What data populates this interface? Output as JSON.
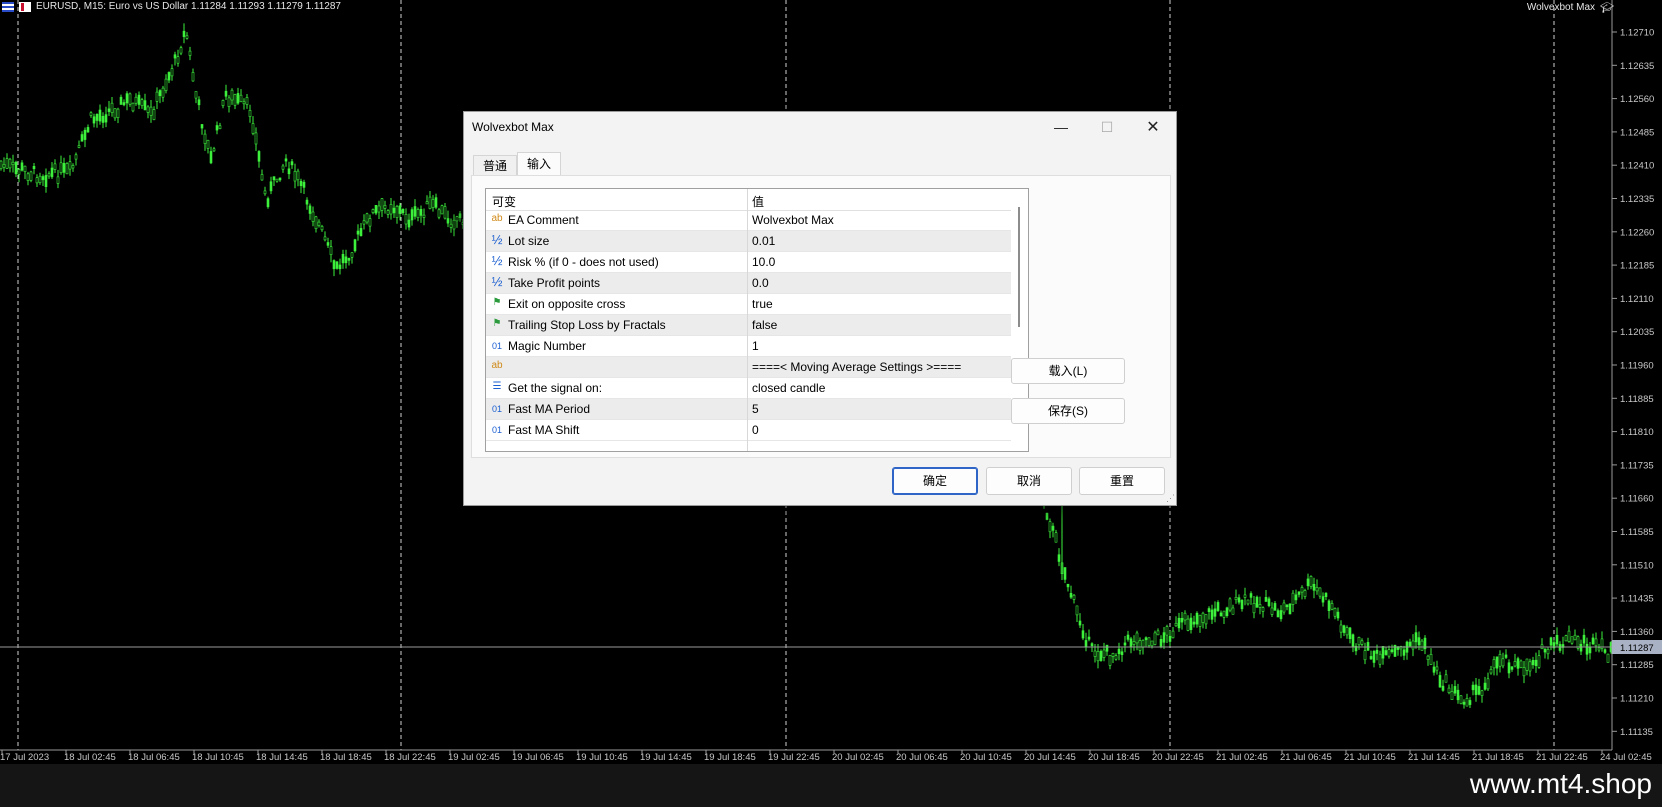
{
  "chart": {
    "header_text": "EURUSD, M15:  Euro vs US Dollar  1.11284 1.11293 1.11279 1.11287",
    "ea_name": "Wolvexbot Max",
    "current_price": "1.11287",
    "candle_color": "#3cf03c",
    "price_ticks": [
      "1.12710",
      "1.12635",
      "1.12560",
      "1.12485",
      "1.12410",
      "1.12335",
      "1.12260",
      "1.12185",
      "1.12110",
      "1.12035",
      "1.11960",
      "1.11885",
      "1.11810",
      "1.11735",
      "1.11660",
      "1.11585",
      "1.11510",
      "1.11435",
      "1.11360",
      "1.11285",
      "1.11210",
      "1.11135"
    ],
    "time_ticks": [
      "17 Jul 2023",
      "18 Jul 02:45",
      "18 Jul 06:45",
      "18 Jul 10:45",
      "18 Jul 14:45",
      "18 Jul 18:45",
      "18 Jul 22:45",
      "19 Jul 02:45",
      "19 Jul 06:45",
      "19 Jul 10:45",
      "19 Jul 14:45",
      "19 Jul 18:45",
      "19 Jul 22:45",
      "20 Jul 02:45",
      "20 Jul 06:45",
      "20 Jul 10:45",
      "20 Jul 14:45",
      "20 Jul 18:45",
      "20 Jul 22:45",
      "21 Jul 02:45",
      "21 Jul 06:45",
      "21 Jul 10:45",
      "21 Jul 14:45",
      "21 Jul 18:45",
      "21 Jul 22:45",
      "24 Jul 02:45"
    ]
  },
  "watermark": "www.mt4.shop",
  "dialog": {
    "title": "Wolvexbot Max",
    "tabs": [
      {
        "label": "普通"
      },
      {
        "label": "输入"
      }
    ],
    "grid": {
      "col_variable": "可变",
      "col_value": "值",
      "rows": [
        {
          "icon": "ab",
          "name": "EA Comment",
          "value": "Wolvexbot Max"
        },
        {
          "icon": "½",
          "name": "Lot size",
          "value": "0.01"
        },
        {
          "icon": "½",
          "name": "Risk % (if 0 - does not used)",
          "value": "10.0"
        },
        {
          "icon": "½",
          "name": "Take Profit points",
          "value": "0.0"
        },
        {
          "icon": "⚑",
          "name": "Exit on opposite cross",
          "value": "true"
        },
        {
          "icon": "⚑",
          "name": "Trailing Stop Loss by Fractals",
          "value": "false"
        },
        {
          "icon": "01",
          "name": "Magic Number",
          "value": "1"
        },
        {
          "icon": "ab",
          "name": "",
          "value": "====< Moving Average Settings >===="
        },
        {
          "icon": "☰",
          "name": "Get the signal on:",
          "value": "closed candle"
        },
        {
          "icon": "01",
          "name": "Fast MA Period",
          "value": "5"
        },
        {
          "icon": "01",
          "name": "Fast MA Shift",
          "value": "0"
        }
      ]
    },
    "buttons": {
      "load": "载入(L)",
      "save": "保存(S)",
      "ok": "确定",
      "cancel": "取消",
      "reset": "重置"
    }
  }
}
